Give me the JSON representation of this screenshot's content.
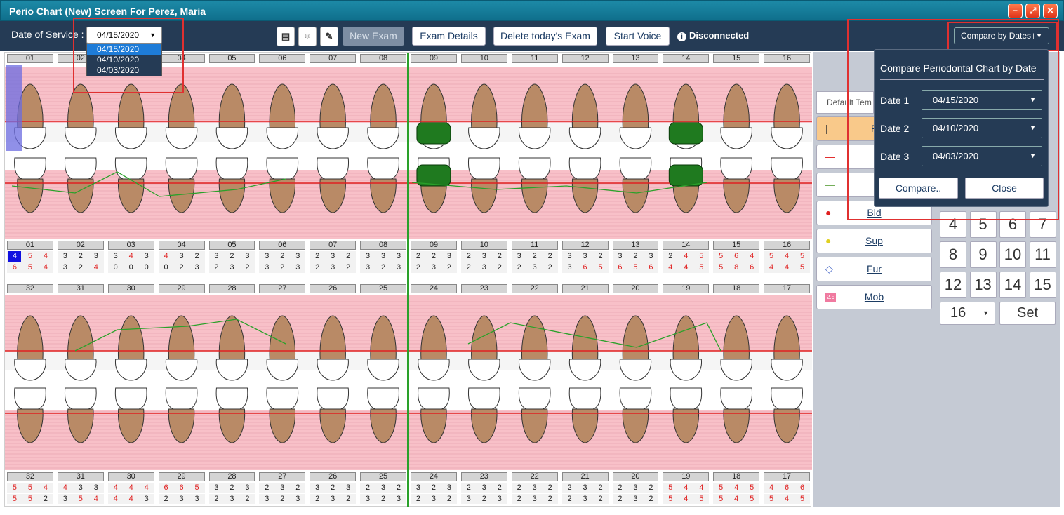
{
  "window": {
    "title": "Perio Chart (New) Screen For Perez, Maria"
  },
  "toolbar": {
    "dos_label": "Date of Service :",
    "dos_value": "04/15/2020",
    "dos_options": [
      "04/15/2020",
      "04/10/2020",
      "04/03/2020"
    ],
    "new_exam": "New Exam",
    "exam_details": "Exam Details",
    "delete_exam": "Delete today's Exam",
    "start_voice": "Start Voice",
    "status": "Disconnected",
    "compare_by_dates": "Compare by Dates"
  },
  "compare_popup": {
    "title": "Compare Periodontal Chart by Date",
    "date1_label": "Date 1",
    "date1": "04/15/2020",
    "date2_label": "Date 2",
    "date2": "04/10/2020",
    "date3_label": "Date 3",
    "date3": "04/03/2020",
    "compare_btn": "Compare..",
    "close_btn": "Close"
  },
  "upper_teeth": [
    "01",
    "02",
    "03",
    "04",
    "05",
    "06",
    "07",
    "08",
    "09",
    "10",
    "11",
    "12",
    "13",
    "14",
    "15",
    "16"
  ],
  "lower_teeth": [
    "32",
    "31",
    "30",
    "29",
    "28",
    "27",
    "26",
    "25",
    "24",
    "23",
    "22",
    "21",
    "20",
    "19",
    "18",
    "17"
  ],
  "upper_row1": [
    [
      "4",
      "5",
      "4"
    ],
    [
      "3",
      "2",
      "3"
    ],
    [
      "3",
      "4",
      "3"
    ],
    [
      "4",
      "3",
      "2"
    ],
    [
      "3",
      "2",
      "3"
    ],
    [
      "3",
      "2",
      "3"
    ],
    [
      "2",
      "3",
      "2"
    ],
    [
      "3",
      "3",
      "3"
    ],
    [
      "2",
      "2",
      "3"
    ],
    [
      "2",
      "3",
      "2"
    ],
    [
      "3",
      "2",
      "2"
    ],
    [
      "3",
      "3",
      "2"
    ],
    [
      "3",
      "2",
      "3"
    ],
    [
      "2",
      "4",
      "5"
    ],
    [
      "5",
      "6",
      "4"
    ],
    [
      "5",
      "4",
      "5"
    ]
  ],
  "upper_row2": [
    [
      "6",
      "5",
      "4"
    ],
    [
      "3",
      "2",
      "4"
    ],
    [
      "0",
      "0",
      "0"
    ],
    [
      "0",
      "2",
      "3"
    ],
    [
      "2",
      "3",
      "2"
    ],
    [
      "3",
      "2",
      "3"
    ],
    [
      "2",
      "3",
      "2"
    ],
    [
      "3",
      "2",
      "3"
    ],
    [
      "2",
      "3",
      "2"
    ],
    [
      "2",
      "3",
      "2"
    ],
    [
      "2",
      "3",
      "2"
    ],
    [
      "3",
      "6",
      "5"
    ],
    [
      "6",
      "5",
      "6"
    ],
    [
      "4",
      "4",
      "5"
    ],
    [
      "5",
      "8",
      "6"
    ],
    [
      "4",
      "4",
      "5"
    ]
  ],
  "lower_row1": [
    [
      "5",
      "5",
      "4"
    ],
    [
      "4",
      "3",
      "3"
    ],
    [
      "4",
      "4",
      "4"
    ],
    [
      "6",
      "6",
      "5"
    ],
    [
      "3",
      "2",
      "3"
    ],
    [
      "2",
      "3",
      "2"
    ],
    [
      "3",
      "2",
      "3"
    ],
    [
      "2",
      "3",
      "2"
    ],
    [
      "3",
      "2",
      "3"
    ],
    [
      "2",
      "3",
      "2"
    ],
    [
      "2",
      "3",
      "2"
    ],
    [
      "2",
      "3",
      "2"
    ],
    [
      "2",
      "3",
      "2"
    ],
    [
      "5",
      "4",
      "4"
    ],
    [
      "5",
      "4",
      "5"
    ],
    [
      "4",
      "6",
      "6"
    ]
  ],
  "lower_row2": [
    [
      "5",
      "5",
      "2"
    ],
    [
      "3",
      "5",
      "4"
    ],
    [
      "4",
      "4",
      "3"
    ],
    [
      "2",
      "3",
      "3"
    ],
    [
      "2",
      "3",
      "2"
    ],
    [
      "3",
      "2",
      "3"
    ],
    [
      "2",
      "3",
      "2"
    ],
    [
      "3",
      "2",
      "3"
    ],
    [
      "2",
      "3",
      "2"
    ],
    [
      "3",
      "2",
      "3"
    ],
    [
      "2",
      "3",
      "2"
    ],
    [
      "2",
      "3",
      "2"
    ],
    [
      "2",
      "3",
      "2"
    ],
    [
      "5",
      "4",
      "5"
    ],
    [
      "5",
      "4",
      "5"
    ],
    [
      "5",
      "4",
      "5"
    ]
  ],
  "sidebar": {
    "template": "Default Tem",
    "items": [
      {
        "label": "P"
      },
      {
        "label": ""
      },
      {
        "label": ""
      },
      {
        "label": "Bld"
      },
      {
        "label": "Sup"
      },
      {
        "label": "Fur"
      },
      {
        "label": "Mob"
      }
    ],
    "mob_badge": "2.5",
    "numpad": [
      "4",
      "5",
      "6",
      "7",
      "8",
      "9",
      "10",
      "11",
      "12",
      "13",
      "14",
      "15"
    ],
    "select_value": "16",
    "set_label": "Set"
  },
  "colors": {
    "accent": "#253b55",
    "pink": "#f8c0c8",
    "red": "#e02020",
    "green": "#2aa12a"
  }
}
